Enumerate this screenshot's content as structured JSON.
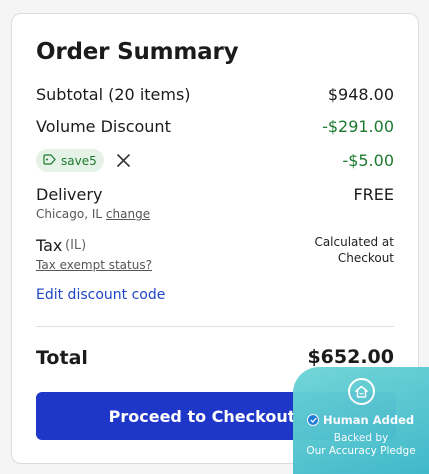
{
  "summary": {
    "title": "Order Summary",
    "subtotal_label": "Subtotal (20 items)",
    "subtotal_value": "$948.00",
    "volume_label": "Volume Discount",
    "volume_value": "-$291.00",
    "coupon_code": "save5",
    "coupon_value": "-$5.00",
    "delivery_label": "Delivery",
    "delivery_value": "FREE",
    "delivery_location": "Chicago, IL",
    "delivery_change": "change",
    "tax_label": "Tax",
    "tax_region": "(IL)",
    "tax_note_line1": "Calculated at",
    "tax_note_line2": "Checkout",
    "tax_exempt_link": "Tax exempt status?",
    "edit_discount": "Edit discount code",
    "total_label": "Total",
    "total_value": "$652.00",
    "checkout_button": "Proceed to Checkout"
  },
  "badge": {
    "headline": "Human Added",
    "sub_line1": "Backed by",
    "sub_line2": "Our Accuracy Pledge"
  },
  "colors": {
    "discount_green": "#1d7a2f",
    "link_blue": "#2046c7",
    "button_blue": "#1f37c9",
    "badge_teal": "#4cc3cf"
  },
  "icons": [
    "tag-icon",
    "close-icon",
    "house-icon",
    "check-icon"
  ]
}
